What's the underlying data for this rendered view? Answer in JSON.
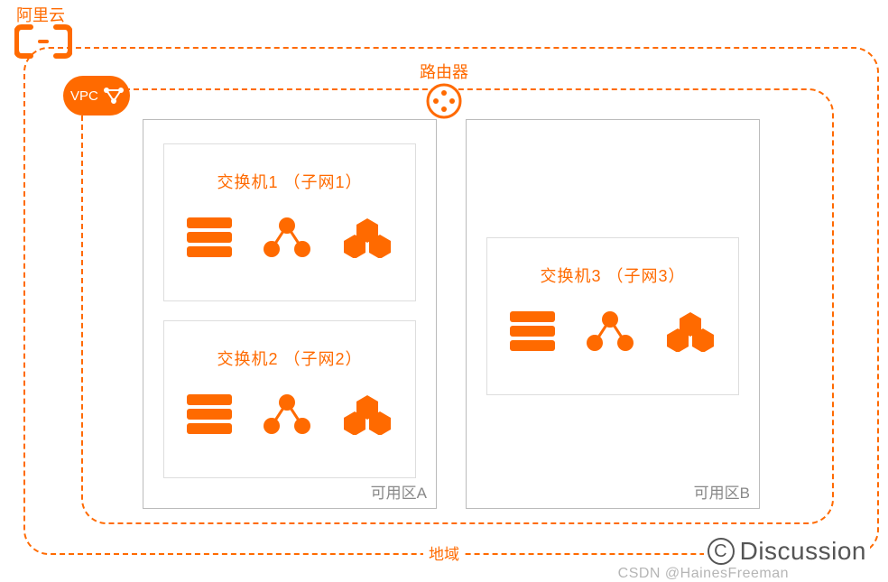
{
  "cloud": {
    "provider": "阿里云"
  },
  "vpc": {
    "badge": "VPC"
  },
  "router": {
    "label": "路由器"
  },
  "region": {
    "label": "地域"
  },
  "zones": {
    "a": {
      "label": "可用区A"
    },
    "b": {
      "label": "可用区B"
    }
  },
  "subnets": {
    "s1": {
      "title": "交换机1 （子网1）"
    },
    "s2": {
      "title": "交换机2 （子网2）"
    },
    "s3": {
      "title": "交换机3 （子网3）"
    }
  },
  "icons": {
    "server": "server-icon",
    "cluster": "cluster-icon",
    "hexes": "hex-cluster-icon",
    "router": "router-icon",
    "logo": "aliyun-bracket-icon",
    "cloud": "vpc-cloud-icon"
  },
  "watermark": {
    "discussion": "Discussion",
    "csdn": "CSDN @HainesFreeman"
  },
  "colors": {
    "accent": "#ff6a00"
  }
}
